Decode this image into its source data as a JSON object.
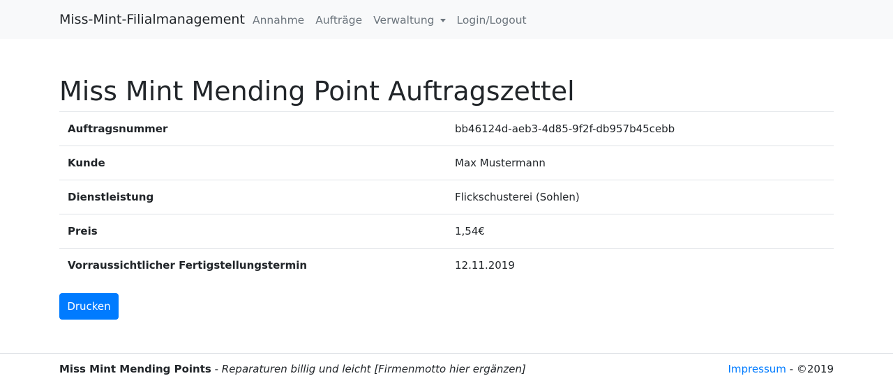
{
  "navbar": {
    "brand": "Miss-Mint-Filialmanagement",
    "links": [
      {
        "label": "Annahme"
      },
      {
        "label": "Aufträge"
      },
      {
        "label": "Verwaltung"
      },
      {
        "label": "Login/Logout"
      }
    ]
  },
  "page": {
    "title": "Miss Mint Mending Point Auftragszettel"
  },
  "details": {
    "rows": [
      {
        "label": "Auftragsnummer",
        "value": "bb46124d-aeb3-4d85-9f2f-db957b45cebb"
      },
      {
        "label": "Kunde",
        "value": "Max Mustermann"
      },
      {
        "label": "Dienstleistung",
        "value": "Flickschusterei (Sohlen)"
      },
      {
        "label": "Preis",
        "value": "1,54€"
      },
      {
        "label": "Vorraussichtlicher Fertigstellungstermin",
        "value": "12.11.2019"
      }
    ]
  },
  "actions": {
    "print_label": "Drucken"
  },
  "footer": {
    "company": "Miss Mint Mending Points",
    "separator": " - ",
    "motto": "Reparaturen billig und leicht [Firmenmotto hier ergänzen]",
    "impressum": "Impressum",
    "copyright": " - ©2019"
  },
  "colors": {
    "primary": "#007bff",
    "navbar_bg": "#f8f9fa",
    "nav_link": "#6c757d",
    "text": "#212529",
    "border": "#dee2e6"
  }
}
